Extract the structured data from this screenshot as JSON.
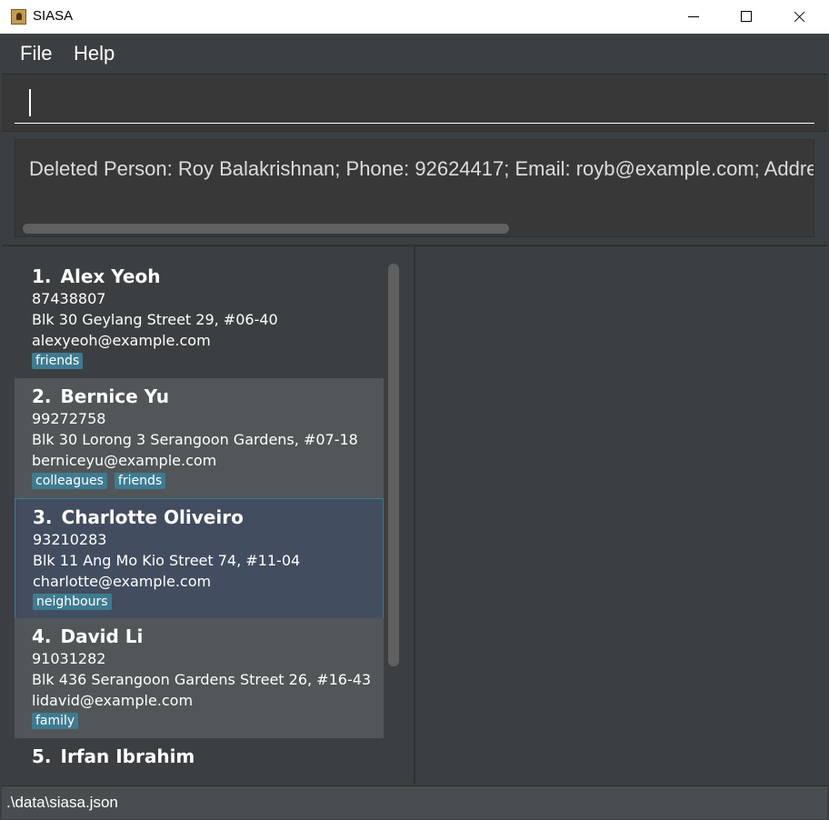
{
  "window": {
    "title": "SIASA",
    "icon": "address-book-icon"
  },
  "menu": {
    "file": "File",
    "help": "Help"
  },
  "command": {
    "value": "",
    "placeholder": ""
  },
  "result": {
    "text": "Deleted Person: Roy Balakrishnan; Phone: 92624417; Email: royb@example.com; Address"
  },
  "persons": [
    {
      "index": "1.",
      "name": "Alex Yeoh",
      "phone": "87438807",
      "address": "Blk 30 Geylang Street 29, #06-40",
      "email": "alexyeoh@example.com",
      "tags": [
        "friends"
      ]
    },
    {
      "index": "2.",
      "name": "Bernice Yu",
      "phone": "99272758",
      "address": "Blk 30 Lorong 3 Serangoon Gardens, #07-18",
      "email": "berniceyu@example.com",
      "tags": [
        "colleagues",
        "friends"
      ]
    },
    {
      "index": "3.",
      "name": "Charlotte Oliveiro",
      "phone": "93210283",
      "address": "Blk 11 Ang Mo Kio Street 74, #11-04",
      "email": "charlotte@example.com",
      "tags": [
        "neighbours"
      ]
    },
    {
      "index": "4.",
      "name": "David Li",
      "phone": "91031282",
      "address": "Blk 436 Serangoon Gardens Street 26, #16-43",
      "email": "lidavid@example.com",
      "tags": [
        "family"
      ]
    },
    {
      "index": "5.",
      "name": "Irfan Ibrahim"
    }
  ],
  "selected_index": 2,
  "status": {
    "path": ".\\data\\siasa.json"
  },
  "colors": {
    "background": "#3c3f41",
    "card_alt": "#515658",
    "selected": "#424d5f",
    "tag": "#3e7b91"
  }
}
